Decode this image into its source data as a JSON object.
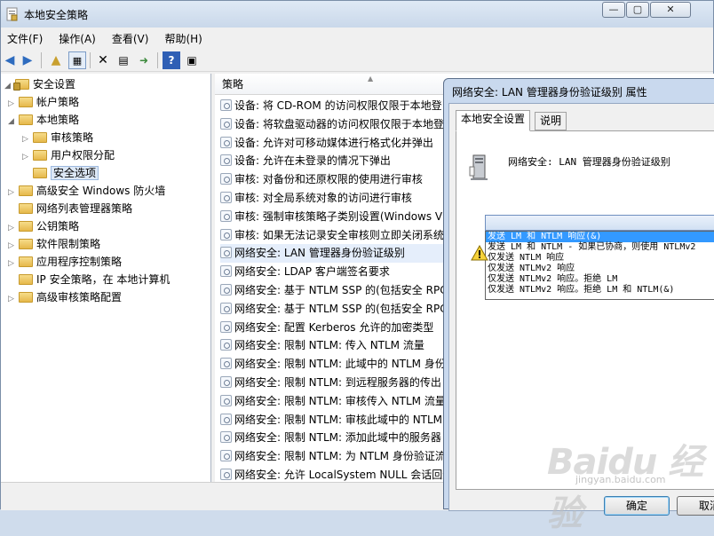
{
  "window": {
    "title": "本地安全策略"
  },
  "menu": [
    "文件(F)",
    "操作(A)",
    "查看(V)",
    "帮助(H)"
  ],
  "tree": [
    {
      "label": "安全设置",
      "level": 0,
      "expanded": true
    },
    {
      "label": "帐户策略",
      "level": 1,
      "expanded": false
    },
    {
      "label": "本地策略",
      "level": 1,
      "expanded": true
    },
    {
      "label": "审核策略",
      "level": 2,
      "expanded": false
    },
    {
      "label": "用户权限分配",
      "level": 2,
      "expanded": false
    },
    {
      "label": "安全选项",
      "level": 2,
      "selected": true
    },
    {
      "label": "高级安全 Windows 防火墙",
      "level": 1,
      "expanded": false
    },
    {
      "label": "网络列表管理器策略",
      "level": 1
    },
    {
      "label": "公钥策略",
      "level": 1,
      "expanded": false
    },
    {
      "label": "软件限制策略",
      "level": 1,
      "expanded": false
    },
    {
      "label": "应用程序控制策略",
      "level": 1,
      "expanded": false
    },
    {
      "label": "IP 安全策略，在 本地计算机",
      "level": 1
    },
    {
      "label": "高级审核策略配置",
      "level": 1,
      "expanded": false
    }
  ],
  "list": {
    "column": "策略",
    "rows": [
      "设备: 将 CD-ROM 的访问权限仅限于本地登",
      "设备: 将软盘驱动器的访问权限仅限于本地登",
      "设备: 允许对可移动媒体进行格式化并弹出",
      "设备: 允许在未登录的情况下弹出",
      "审核: 对备份和还原权限的使用进行审核",
      "审核: 对全局系统对象的访问进行审核",
      "审核: 强制审核策略子类别设置(Windows V",
      "审核: 如果无法记录安全审核则立即关闭系统",
      "网络安全: LAN 管理器身份验证级别",
      "网络安全: LDAP 客户端签名要求",
      "网络安全: 基于 NTLM SSP 的(包括安全 RPC",
      "网络安全: 基于 NTLM SSP 的(包括安全 RPC",
      "网络安全: 配置 Kerberos 允许的加密类型",
      "网络安全: 限制 NTLM: 传入 NTLM 流量",
      "网络安全: 限制 NTLM: 此域中的 NTLM 身份",
      "网络安全: 限制 NTLM: 到远程服务器的传出",
      "网络安全: 限制 NTLM: 审核传入 NTLM 流量",
      "网络安全: 限制 NTLM: 审核此域中的 NTLM",
      "网络安全: 限制 NTLM: 添加此域中的服务器",
      "网络安全: 限制 NTLM: 为 NTLM 身份验证流",
      "网络安全: 允许 LocalSystem NULL 会话回退"
    ],
    "selected_index": 8
  },
  "dialog": {
    "title": "网络安全: LAN 管理器身份验证级别 属性",
    "tabs": [
      "本地安全设置",
      "说明"
    ],
    "setting_name": "网络安全: LAN 管理器身份验证级别",
    "dropdown_value": "",
    "options": [
      "发送 LM 和 NTLM 响应(&)",
      "发送 LM 和 NTLM - 如果已协商，则使用 NTLMv2",
      "仅发送 NTLM 响应",
      "仅发送 NTLMv2 响应",
      "仅发送 NTLMv2 响应。拒绝 LM",
      "仅发送 NTLMv2 响应。拒绝 LM 和 NTLM(&)"
    ],
    "selected_option": 0,
    "ok_label": "确定",
    "cancel_label": "取消"
  },
  "watermark": {
    "text": "Baidu 经验",
    "sub": "jingyan.baidu.com"
  }
}
